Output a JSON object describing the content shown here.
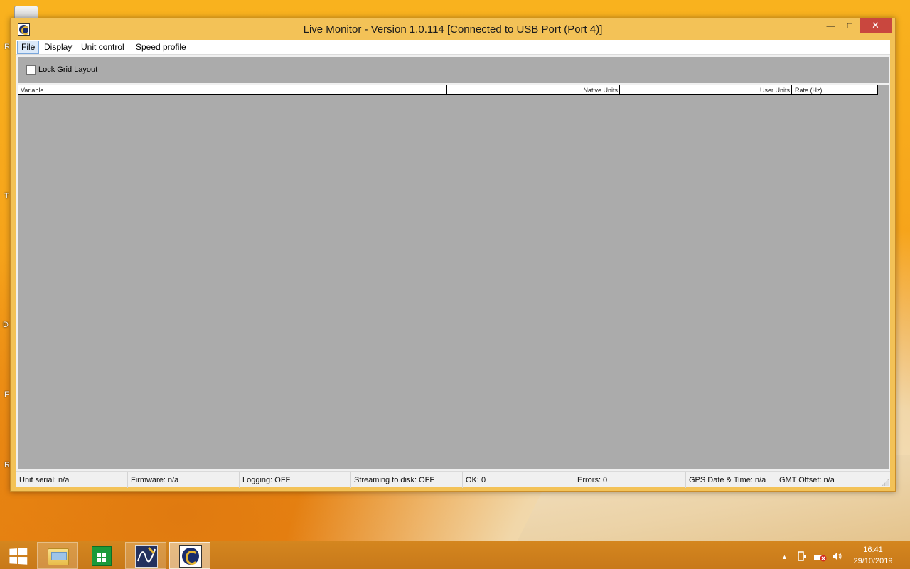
{
  "window": {
    "title": "Live Monitor - Version 1.0.114 [Connected to USB Port (Port 4)]",
    "minimize_glyph": "—",
    "maximize_glyph": "□",
    "close_glyph": "✕"
  },
  "menu": {
    "items": [
      "File",
      "Display",
      "Unit control",
      "Speed profile"
    ],
    "active": "File"
  },
  "toolbar": {
    "lock_grid_label": "Lock Grid Layout",
    "lock_grid_checked": false
  },
  "grid": {
    "columns": [
      "Variable",
      "Native Units",
      "User Units",
      "Rate (Hz)"
    ],
    "rows": []
  },
  "statusbar": {
    "unit_serial": "Unit serial: n/a",
    "firmware": "Firmware: n/a",
    "logging": "Logging: OFF",
    "streaming": "Streaming to disk: OFF",
    "ok": "OK: 0",
    "errors": "Errors: 0",
    "gps": "GPS Date & Time: n/a",
    "gmt_offset": "GMT Offset: n/a"
  },
  "taskbar": {
    "apps": [
      "start-icon",
      "file-explorer-icon",
      "store-icon",
      "waveform-app-icon",
      "live-monitor-icon"
    ],
    "active_app": "live-monitor-icon",
    "tray": {
      "show_hidden_glyph": "▲",
      "time": "16:41",
      "date": "29/10/2019"
    }
  },
  "desktop": {
    "fragments": [
      "R",
      "T",
      "D",
      "F",
      "R"
    ]
  },
  "colors": {
    "titlebar": "#f3c257",
    "close_button": "#c9473e",
    "grid_background": "#ababab",
    "taskbar": "#c8791a"
  }
}
